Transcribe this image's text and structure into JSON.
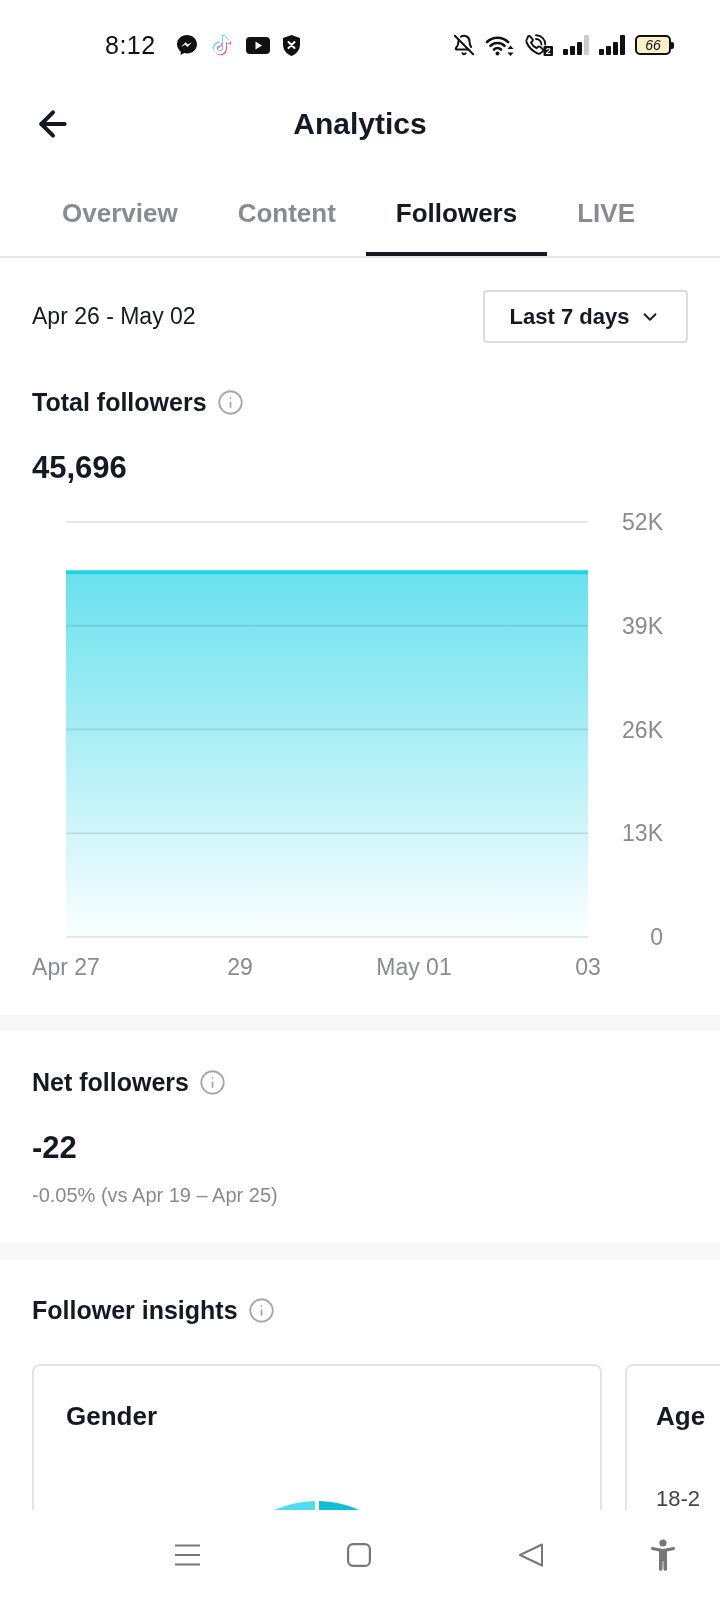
{
  "status_bar": {
    "time": "8:12",
    "sim_badge": "2",
    "battery": "66"
  },
  "header": {
    "title": "Analytics"
  },
  "tabs": [
    {
      "label": "Overview",
      "selected": false
    },
    {
      "label": "Content",
      "selected": false
    },
    {
      "label": "Followers",
      "selected": true
    },
    {
      "label": "LIVE",
      "selected": false
    }
  ],
  "date_range": {
    "label": "Apr 26 - May 02",
    "period": "Last 7 days"
  },
  "total_followers": {
    "title": "Total followers",
    "value": "45,696",
    "chart_data": {
      "type": "area",
      "categories": [
        "Apr 27",
        null,
        "29",
        null,
        "May 01",
        null,
        "03"
      ],
      "series": [
        {
          "color": "#22d3e6",
          "values": [
            45700,
            45700,
            45700,
            45700,
            45700,
            45700,
            45700
          ]
        }
      ],
      "ylim": [
        0,
        52000
      ],
      "yticks": [
        {
          "value": 0,
          "label": "0"
        },
        {
          "value": 13000,
          "label": "13K"
        },
        {
          "value": 26000,
          "label": "26K"
        },
        {
          "value": 39000,
          "label": "39K"
        },
        {
          "value": 52000,
          "label": "52K"
        }
      ],
      "grid": true
    }
  },
  "net_followers": {
    "title": "Net followers",
    "value": "-22",
    "change": "-0.05% (vs Apr 19 – Apr 25)"
  },
  "follower_insights": {
    "title": "Follower insights",
    "cards": [
      {
        "kind": "gender",
        "title": "Gender"
      },
      {
        "kind": "age",
        "title": "Age",
        "rows": [
          "18-2"
        ]
      }
    ]
  }
}
